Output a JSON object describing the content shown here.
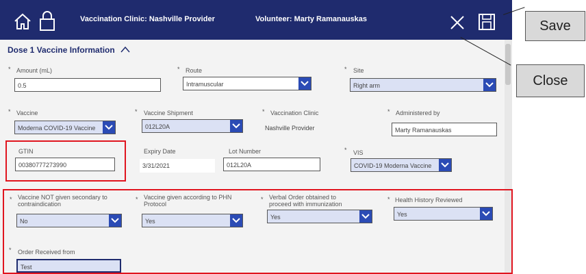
{
  "header": {
    "title": "Vaccination Clinic: Nashville Provider",
    "volunteer": "Volunteer: Marty  Ramanauskas"
  },
  "section": {
    "title": "Dose 1 Vaccine Information"
  },
  "fields": {
    "amount": {
      "label": "Amount (mL)",
      "value": "0.5"
    },
    "route": {
      "label": "Route",
      "value": "Intramuscular"
    },
    "site": {
      "label": "Site",
      "value": "Right arm"
    },
    "vaccine": {
      "label": "Vaccine",
      "value": "Moderna COVID-19 Vaccine"
    },
    "shipment": {
      "label": "Vaccine Shipment",
      "value": "012L20A"
    },
    "clinic": {
      "label": "Vaccination Clinic",
      "value": "Nashville Provider"
    },
    "administered": {
      "label": "Administered by",
      "value": "Marty  Ramanauskas"
    },
    "gtin": {
      "label": "GTIN",
      "value": "00380777273990"
    },
    "expiry": {
      "label": "Expiry Date",
      "value": "3/31/2021"
    },
    "lot": {
      "label": "Lot Number",
      "value": "012L20A"
    },
    "vis": {
      "label": "VIS",
      "value": "COVID-19 Moderna Vaccine"
    },
    "not_given": {
      "label_line1": "Vaccine NOT given secondary to",
      "label_line2": "contraindication",
      "value": "No"
    },
    "phn": {
      "label_line1": "Vaccine given according to PHN",
      "label_line2": "Protocol",
      "value": "Yes"
    },
    "verbal": {
      "label_line1": "Verbal Order obtained to",
      "label_line2": "proceed with immunization",
      "value": "Yes"
    },
    "health": {
      "label": "Health History Reviewed",
      "value": "Yes"
    },
    "order": {
      "label": "Order Received from",
      "value": "Test"
    }
  },
  "callouts": {
    "save": "Save",
    "close": "Close"
  },
  "icons": {
    "home": "home-icon",
    "lock": "lock-icon",
    "close": "close-icon",
    "save": "save-icon",
    "chevron_up": "chevron-up-icon",
    "dropdown": "chevron-down-icon"
  },
  "colors": {
    "header_bg": "#1f2b6e",
    "dropdown_bg": "#2b4bb5",
    "highlight_box": "#e0141e"
  }
}
